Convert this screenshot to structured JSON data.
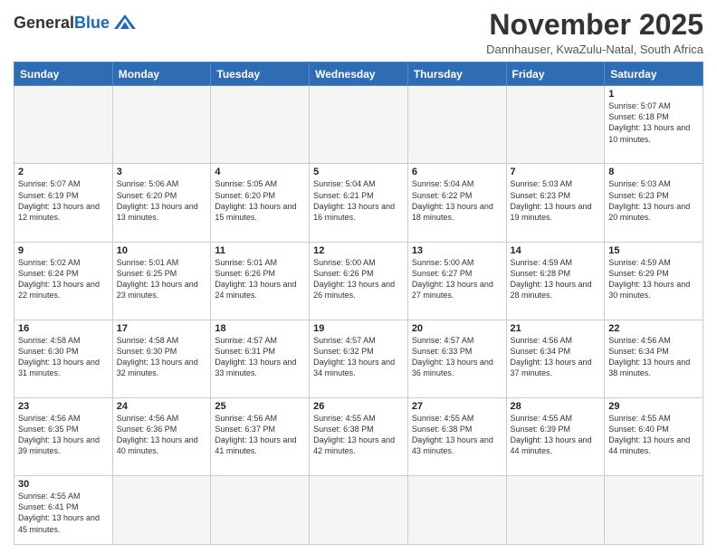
{
  "header": {
    "logo_general": "General",
    "logo_blue": "Blue",
    "month_title": "November 2025",
    "subtitle": "Dannhauser, KwaZulu-Natal, South Africa"
  },
  "weekdays": [
    "Sunday",
    "Monday",
    "Tuesday",
    "Wednesday",
    "Thursday",
    "Friday",
    "Saturday"
  ],
  "weeks": [
    [
      {
        "day": "",
        "info": ""
      },
      {
        "day": "",
        "info": ""
      },
      {
        "day": "",
        "info": ""
      },
      {
        "day": "",
        "info": ""
      },
      {
        "day": "",
        "info": ""
      },
      {
        "day": "",
        "info": ""
      },
      {
        "day": "1",
        "info": "Sunrise: 5:07 AM\nSunset: 6:18 PM\nDaylight: 13 hours\nand 10 minutes."
      }
    ],
    [
      {
        "day": "2",
        "info": "Sunrise: 5:07 AM\nSunset: 6:19 PM\nDaylight: 13 hours\nand 12 minutes."
      },
      {
        "day": "3",
        "info": "Sunrise: 5:06 AM\nSunset: 6:20 PM\nDaylight: 13 hours\nand 13 minutes."
      },
      {
        "day": "4",
        "info": "Sunrise: 5:05 AM\nSunset: 6:20 PM\nDaylight: 13 hours\nand 15 minutes."
      },
      {
        "day": "5",
        "info": "Sunrise: 5:04 AM\nSunset: 6:21 PM\nDaylight: 13 hours\nand 16 minutes."
      },
      {
        "day": "6",
        "info": "Sunrise: 5:04 AM\nSunset: 6:22 PM\nDaylight: 13 hours\nand 18 minutes."
      },
      {
        "day": "7",
        "info": "Sunrise: 5:03 AM\nSunset: 6:23 PM\nDaylight: 13 hours\nand 19 minutes."
      },
      {
        "day": "8",
        "info": "Sunrise: 5:03 AM\nSunset: 6:23 PM\nDaylight: 13 hours\nand 20 minutes."
      }
    ],
    [
      {
        "day": "9",
        "info": "Sunrise: 5:02 AM\nSunset: 6:24 PM\nDaylight: 13 hours\nand 22 minutes."
      },
      {
        "day": "10",
        "info": "Sunrise: 5:01 AM\nSunset: 6:25 PM\nDaylight: 13 hours\nand 23 minutes."
      },
      {
        "day": "11",
        "info": "Sunrise: 5:01 AM\nSunset: 6:26 PM\nDaylight: 13 hours\nand 24 minutes."
      },
      {
        "day": "12",
        "info": "Sunrise: 5:00 AM\nSunset: 6:26 PM\nDaylight: 13 hours\nand 26 minutes."
      },
      {
        "day": "13",
        "info": "Sunrise: 5:00 AM\nSunset: 6:27 PM\nDaylight: 13 hours\nand 27 minutes."
      },
      {
        "day": "14",
        "info": "Sunrise: 4:59 AM\nSunset: 6:28 PM\nDaylight: 13 hours\nand 28 minutes."
      },
      {
        "day": "15",
        "info": "Sunrise: 4:59 AM\nSunset: 6:29 PM\nDaylight: 13 hours\nand 30 minutes."
      }
    ],
    [
      {
        "day": "16",
        "info": "Sunrise: 4:58 AM\nSunset: 6:30 PM\nDaylight: 13 hours\nand 31 minutes."
      },
      {
        "day": "17",
        "info": "Sunrise: 4:58 AM\nSunset: 6:30 PM\nDaylight: 13 hours\nand 32 minutes."
      },
      {
        "day": "18",
        "info": "Sunrise: 4:57 AM\nSunset: 6:31 PM\nDaylight: 13 hours\nand 33 minutes."
      },
      {
        "day": "19",
        "info": "Sunrise: 4:57 AM\nSunset: 6:32 PM\nDaylight: 13 hours\nand 34 minutes."
      },
      {
        "day": "20",
        "info": "Sunrise: 4:57 AM\nSunset: 6:33 PM\nDaylight: 13 hours\nand 36 minutes."
      },
      {
        "day": "21",
        "info": "Sunrise: 4:56 AM\nSunset: 6:34 PM\nDaylight: 13 hours\nand 37 minutes."
      },
      {
        "day": "22",
        "info": "Sunrise: 4:56 AM\nSunset: 6:34 PM\nDaylight: 13 hours\nand 38 minutes."
      }
    ],
    [
      {
        "day": "23",
        "info": "Sunrise: 4:56 AM\nSunset: 6:35 PM\nDaylight: 13 hours\nand 39 minutes."
      },
      {
        "day": "24",
        "info": "Sunrise: 4:56 AM\nSunset: 6:36 PM\nDaylight: 13 hours\nand 40 minutes."
      },
      {
        "day": "25",
        "info": "Sunrise: 4:56 AM\nSunset: 6:37 PM\nDaylight: 13 hours\nand 41 minutes."
      },
      {
        "day": "26",
        "info": "Sunrise: 4:55 AM\nSunset: 6:38 PM\nDaylight: 13 hours\nand 42 minutes."
      },
      {
        "day": "27",
        "info": "Sunrise: 4:55 AM\nSunset: 6:38 PM\nDaylight: 13 hours\nand 43 minutes."
      },
      {
        "day": "28",
        "info": "Sunrise: 4:55 AM\nSunset: 6:39 PM\nDaylight: 13 hours\nand 44 minutes."
      },
      {
        "day": "29",
        "info": "Sunrise: 4:55 AM\nSunset: 6:40 PM\nDaylight: 13 hours\nand 44 minutes."
      }
    ],
    [
      {
        "day": "30",
        "info": "Sunrise: 4:55 AM\nSunset: 6:41 PM\nDaylight: 13 hours\nand 45 minutes."
      },
      {
        "day": "",
        "info": ""
      },
      {
        "day": "",
        "info": ""
      },
      {
        "day": "",
        "info": ""
      },
      {
        "day": "",
        "info": ""
      },
      {
        "day": "",
        "info": ""
      },
      {
        "day": "",
        "info": ""
      }
    ]
  ]
}
